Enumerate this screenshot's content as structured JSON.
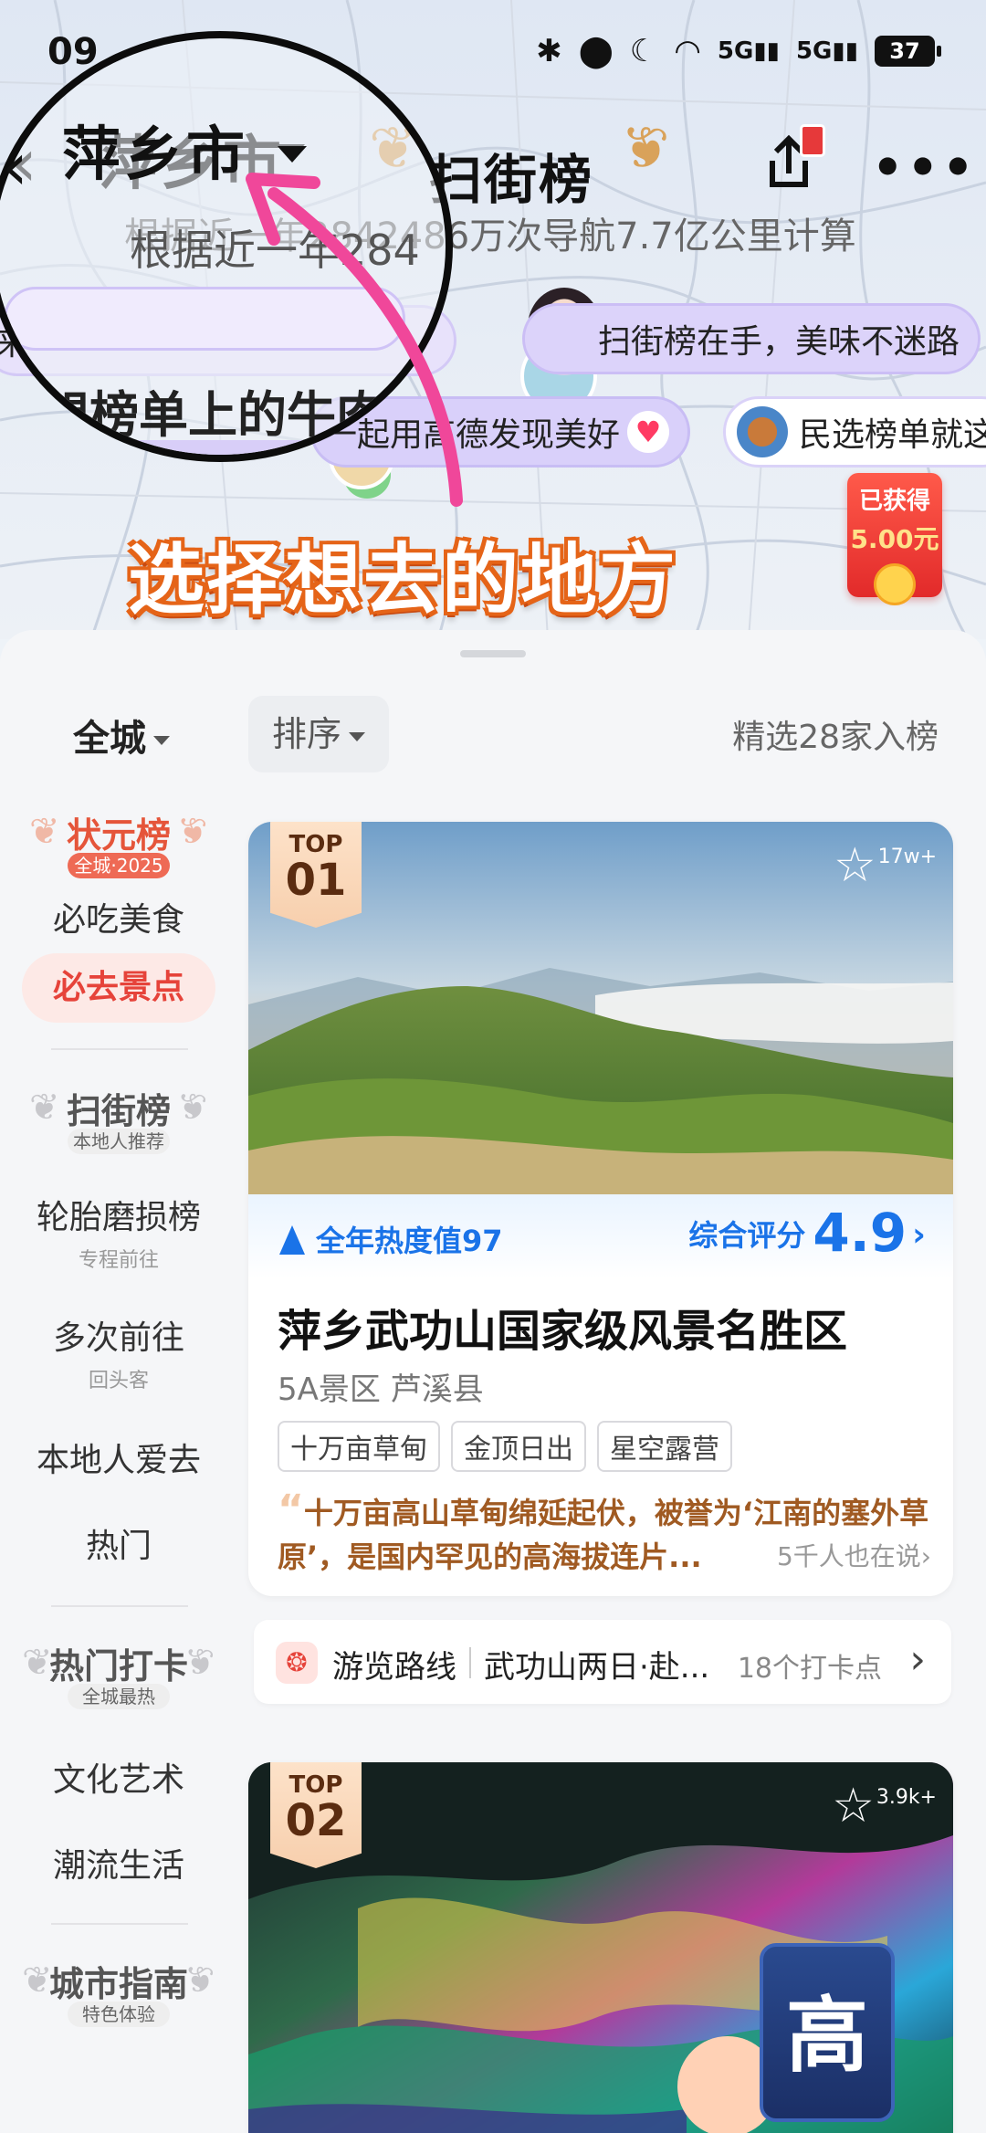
{
  "status_bar": {
    "time": "09",
    "battery": "37",
    "icons": [
      "bluetooth-icon",
      "location-icon",
      "moon-icon",
      "wifi-icon",
      "5g-signal-icon",
      "5g-signal-icon"
    ]
  },
  "header": {
    "city": "萍乡市",
    "brand": "扫街榜",
    "subtitle": "根据近一年2842486万次导航7.7亿公里计算",
    "subtitle_zoomed": "根据近一年284"
  },
  "bubbles": [
    {
      "text": "扫街榜在手，美味不迷路"
    },
    {
      "text": "一起用高德发现美好"
    },
    {
      "text": "民选榜单就这"
    },
    {
      "text": "来"
    }
  ],
  "zoom_text": "想榜单上的牛肉",
  "cta_text": "选择想去的地方",
  "red_packet": {
    "label": "已获得",
    "amount": "5.00元"
  },
  "filter": {
    "city": "全城",
    "sort": "排序",
    "count": "精选28家入榜"
  },
  "sidebar": {
    "groups": [
      {
        "title": "状元榜",
        "sub": "全城·2025",
        "color": "#e5553a"
      },
      {
        "title": "扫街榜",
        "sub": "本地人推荐",
        "color": "#555555"
      },
      {
        "title": "热门打卡",
        "sub": "全城最热",
        "color": "#555555"
      },
      {
        "title": "城市指南",
        "sub": "特色体验",
        "color": "#555555"
      }
    ],
    "items": [
      {
        "label": "必吃美食"
      },
      {
        "label": "必去景点"
      },
      {
        "label": "轮胎磨损榜",
        "sub": "专程前往"
      },
      {
        "label": "多次前往",
        "sub": "回头客"
      },
      {
        "label": "本地人爱去"
      },
      {
        "label": "热门"
      },
      {
        "label": "文化艺术"
      },
      {
        "label": "潮流生活"
      }
    ]
  },
  "cards": [
    {
      "rank_label": "TOP",
      "rank": "01",
      "fav_count": "17w+",
      "heat": "全年热度值97",
      "score_label": "综合评分",
      "score": "4.9",
      "title": "萍乡武功山国家级风景名胜区",
      "meta": "5A景区 芦溪县",
      "tags": [
        "十万亩草甸",
        "金顶日出",
        "星空露营"
      ],
      "quote": "十万亩高山草甸绵延起伏，被誉为‘江南的塞外草原’，是国内罕见的高海拔连片...",
      "talk": "5千人也在说›"
    },
    {
      "rank_label": "TOP",
      "rank": "02",
      "fav_count": "3.9k+",
      "overlay_char": "高"
    }
  ],
  "route": {
    "label": "游览路线",
    "title": "武功山两日·赴...",
    "count": "18个打卡点"
  }
}
